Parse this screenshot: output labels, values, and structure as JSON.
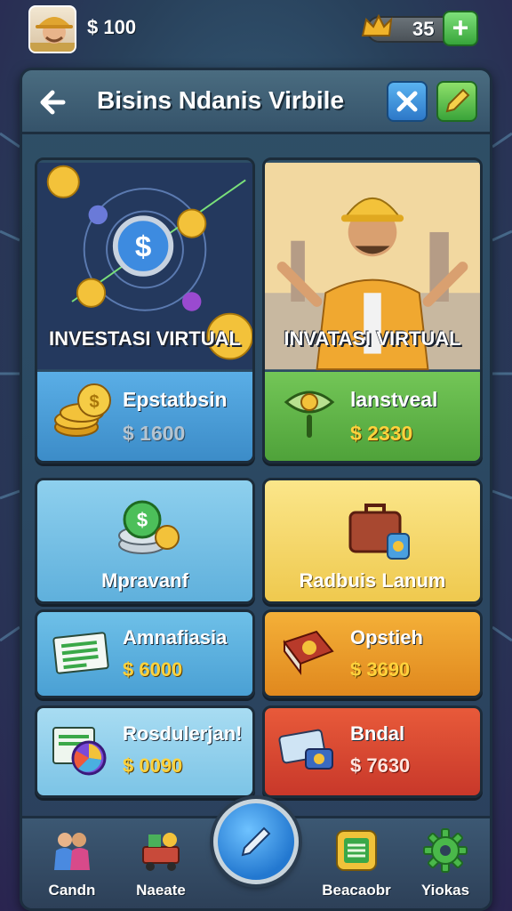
{
  "topbar": {
    "money": "$ 100",
    "gems": "35",
    "add_label": "+"
  },
  "header": {
    "title": "Bisins Ndanis Virbile"
  },
  "cards": [
    {
      "art_label": "INVESTASI VIRTUAL",
      "label": "Epstatbsin",
      "price": "$ 1600",
      "price_color": "#b5c4d0"
    },
    {
      "art_label": "INVATASI VIRTUAL",
      "label": "lanstveal",
      "price": "$ 2330",
      "price_color": "#ffd23c"
    }
  ],
  "tiles": [
    {
      "label": "Mpravanf",
      "price": ""
    },
    {
      "label": "Radbuis Lanum",
      "price": ""
    },
    {
      "label": "Amnafiasia",
      "price": "$ 6000"
    },
    {
      "label": "Opstieh",
      "price": "$ 3690"
    },
    {
      "label": "Rosdulerjan!",
      "price": "$ 0090"
    },
    {
      "label": "Bndal",
      "price": "$ 7630"
    }
  ],
  "nav": [
    {
      "label": "Candn"
    },
    {
      "label": "Naeate"
    },
    {
      "label": "Beacaobr"
    },
    {
      "label": "Yiokas"
    }
  ],
  "colors": {
    "card_blue": "#4d9fd6",
    "card_green": "#5fb84a",
    "tile_yellow": "#f4d86a",
    "tile_orange": "#e8962a",
    "tile_red": "#d84a32"
  }
}
